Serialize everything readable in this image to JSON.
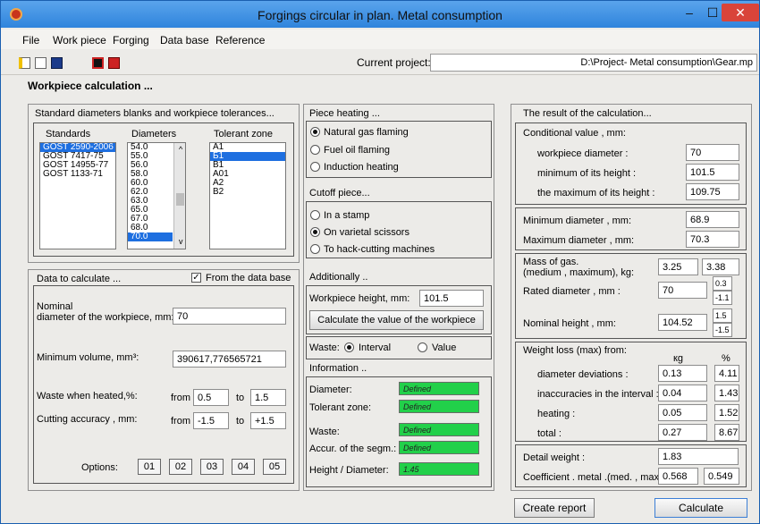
{
  "window": {
    "title": "Forgings circular in plan. Metal consumption",
    "min": "–",
    "max": "☐",
    "close": "✕"
  },
  "menu": [
    "File",
    "Work piece",
    "Forging",
    "Data base",
    "Reference"
  ],
  "project": {
    "label": "Current project:",
    "value": "D:\\Project- Metal consumption\\Gear.mp"
  },
  "section_title": "Workpiece  calculation ...",
  "standards": {
    "title": "Standard diameters blanks and workpiece tolerances...",
    "col_standards": "Standards",
    "col_diameters": "Diameters",
    "col_tolerant": "Tolerant zone",
    "standards_list": [
      "GOST 2590-2006",
      "GOST 7417-75",
      "GOST 14955-77",
      "GOST 1133-71"
    ],
    "diameters_list": [
      "54.0",
      "55.0",
      "56.0",
      "58.0",
      "60.0",
      "62.0",
      "63.0",
      "65.0",
      "67.0",
      "68.0",
      "70.0"
    ],
    "tolerant_list": [
      "A1",
      "Б1",
      "B1",
      "A01",
      "A2",
      "B2"
    ]
  },
  "data_calc": {
    "title": "Data to calculate ...",
    "from_db": "From the data base",
    "nominal_label": "Nominal\ndiameter of the workpiece, mm:",
    "nominal_value": "70",
    "minvol_label": "Minimum volume, mm³:",
    "minvol_value": "390617,776565721",
    "waste_label": "Waste when heated,%:",
    "from": "from",
    "to": "to",
    "waste_from": "0.5",
    "waste_to": "1.5",
    "cut_label": "Cutting accuracy , mm:",
    "cut_from": "-1.5",
    "cut_to": "+1.5",
    "options_label": "Options:",
    "options": [
      "01",
      "02",
      "03",
      "04",
      "05"
    ]
  },
  "heating": {
    "title": "Piece  heating ...",
    "opts": [
      "Natural gas flaming",
      "Fuel oil flaming",
      "Induction heating"
    ]
  },
  "cutoff": {
    "title": "Cutoff piece...",
    "opts": [
      "In a stamp",
      "On varietal scissors",
      "To hack-cutting machines"
    ]
  },
  "additionally": {
    "title": "Additionally ..",
    "height_label": "Workpiece height, mm:",
    "height_value": "101.5",
    "calc_btn": "Calculate the value of the workpiece"
  },
  "waste": {
    "label": "Waste:",
    "interval": "Interval",
    "value": "Value"
  },
  "info": {
    "title": "Information ..",
    "rows": [
      {
        "label": "Diameter:",
        "value": "Defined"
      },
      {
        "label": "Tolerant zone:",
        "value": "Defined"
      },
      {
        "label": "Waste:",
        "value": "Defined"
      },
      {
        "label": "Accur.  of the segm.:",
        "value": "Defined"
      },
      {
        "label": "Height / Diameter:",
        "value": "1.45"
      }
    ]
  },
  "result": {
    "title": "The result of the calculation...",
    "cond_title": "Conditional value , mm:",
    "wp_diam_label": "workpiece diameter :",
    "wp_diam": "70",
    "min_h_label": "minimum of its height :",
    "min_h": "101.5",
    "max_h_label": "the maximum of its height :",
    "max_h": "109.75",
    "min_d_label": "Minimum diameter , mm:",
    "min_d": "68.9",
    "max_d_label": "Maximum diameter , mm:",
    "max_d": "70.3",
    "mass_label": "Mass of gas.\n(medium , maximum), kg:",
    "mass_med": "3.25",
    "mass_max": "3.38",
    "rated_label": "Rated diameter , mm :",
    "rated": "70",
    "rated_up": "0.3",
    "rated_dn": "-1.1",
    "nomh_label": "Nominal height , mm:",
    "nomh": "104.52",
    "nomh_up": "1.5",
    "nomh_dn": "-1.5",
    "loss_label": "Weight loss (max) from:",
    "kg": "кg",
    "pct": "%",
    "loss_rows": [
      {
        "label": "diameter deviations :",
        "kg": "0.13",
        "pct": "4.11"
      },
      {
        "label": "inaccuracies in the interval :",
        "kg": "0.04",
        "pct": "1.43"
      },
      {
        "label": "heating :",
        "kg": "0.05",
        "pct": "1.52"
      },
      {
        "label": "total :",
        "kg": "0.27",
        "pct": "8.67"
      }
    ],
    "detail_label": "Detail weight :",
    "detail": "1.83",
    "coef_label": "Coefficient . metal .(med. , max) :",
    "coef_med": "0.568",
    "coef_max": "0.549"
  },
  "buttons": {
    "report": "Create report",
    "calculate": "Calculate"
  }
}
